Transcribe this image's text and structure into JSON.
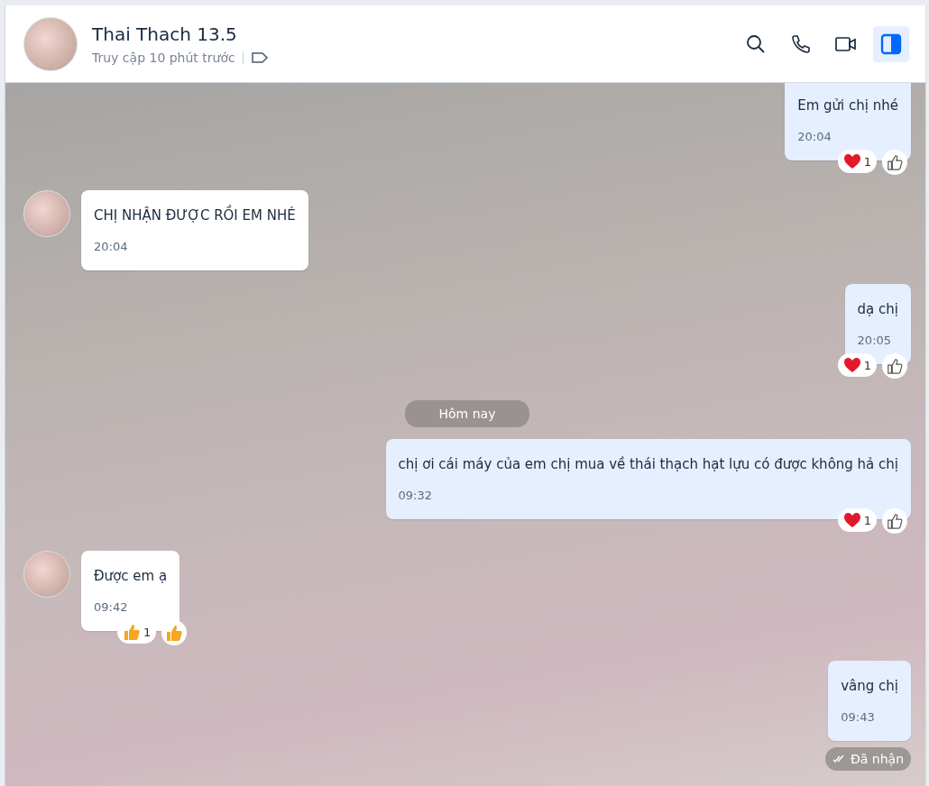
{
  "header": {
    "name": "Thai Thach 13.5",
    "status": "Truy cập 10 phút trước",
    "actions": [
      {
        "kind": "search",
        "selected": false
      },
      {
        "kind": "call",
        "selected": false
      },
      {
        "kind": "video",
        "selected": false
      },
      {
        "kind": "panel",
        "selected": true
      }
    ]
  },
  "messages": [
    {
      "kind": "sent",
      "text": "Em gửi chị nhé",
      "time": "20:04",
      "reactions": [
        {
          "kind": "heart",
          "count": "1"
        }
      ],
      "react_button": {
        "kind": "outline"
      }
    },
    {
      "kind": "received",
      "text": "CHỊ NHẬN ĐƯỢC RỒI EM NHÉ",
      "time": "20:04"
    },
    {
      "kind": "sent",
      "text": "dạ chị",
      "time": "20:05",
      "reactions": [
        {
          "kind": "heart",
          "count": "1"
        }
      ],
      "react_button": {
        "kind": "outline"
      }
    },
    {
      "kind": "date",
      "text": "Hôm nay"
    },
    {
      "kind": "sent",
      "text": "chị ơi cái máy của em chị mua về thái thạch hạt lựu có được không hả chị",
      "time": "09:32",
      "reactions": [
        {
          "kind": "heart",
          "count": "1"
        }
      ],
      "react_button": {
        "kind": "outline"
      }
    },
    {
      "kind": "received",
      "text": "Được em ạ",
      "time": "09:42",
      "reactions": [
        {
          "kind": "like",
          "count": "1"
        }
      ],
      "react_button": {
        "kind": "emoji"
      }
    },
    {
      "kind": "sent",
      "text": "vâng chị",
      "time": "09:43"
    },
    {
      "kind": "status",
      "text": "Đã nhận"
    }
  ]
}
